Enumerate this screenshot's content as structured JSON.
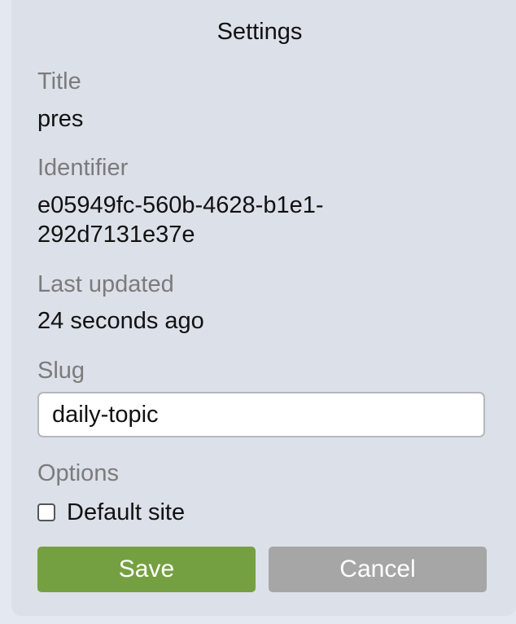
{
  "dialog": {
    "title": "Settings",
    "title_label": "Title",
    "title_value": "pres",
    "identifier_label": "Identifier",
    "identifier_line1": "e05949fc-560b-4628-b1e1-",
    "identifier_line2": "292d7131e37e",
    "last_updated_label": "Last updated",
    "last_updated_value": "24 seconds ago",
    "slug_label": "Slug",
    "slug_value": "daily-topic",
    "options_label": "Options",
    "default_site_label": "Default site",
    "default_site_checked": false
  },
  "buttons": {
    "save_label": "Save",
    "cancel_label": "Cancel"
  },
  "colors": {
    "save": "#75a041",
    "cancel": "#a6a6a6",
    "panel": "#dce0e9",
    "label": "#7b7b7b"
  }
}
